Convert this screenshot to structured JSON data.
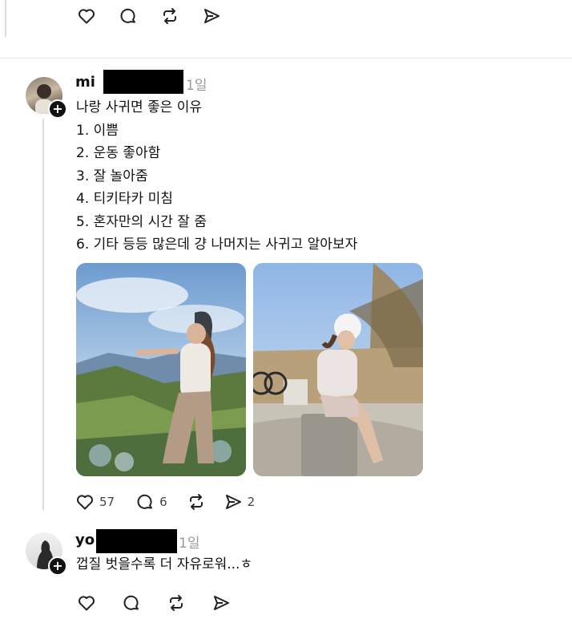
{
  "top_post": {
    "actions": [
      "heart-icon",
      "comment-icon",
      "repost-icon",
      "share-icon"
    ]
  },
  "post1": {
    "username": "mi",
    "time": "1일",
    "lines": [
      "나랑 사귀면 좋은 이유",
      "1. 이쁨",
      "2. 운동 좋아함",
      "3. 잘 놀아줌",
      "4. 티키타카 미침",
      "5. 혼자만의 시간 잘 줌",
      "6. 기타 등등 많은데 걍 나머지는 사귀고 알아보자"
    ],
    "likes": "57",
    "comments": "6",
    "shares": "2"
  },
  "post2": {
    "username": "yo",
    "time": "1일",
    "text": "껍질 벗을수록 더 자유로워...ㅎ"
  },
  "colors": {
    "icon": "#222222",
    "muted": "#999999",
    "thread_line": "#dcdcdc"
  }
}
